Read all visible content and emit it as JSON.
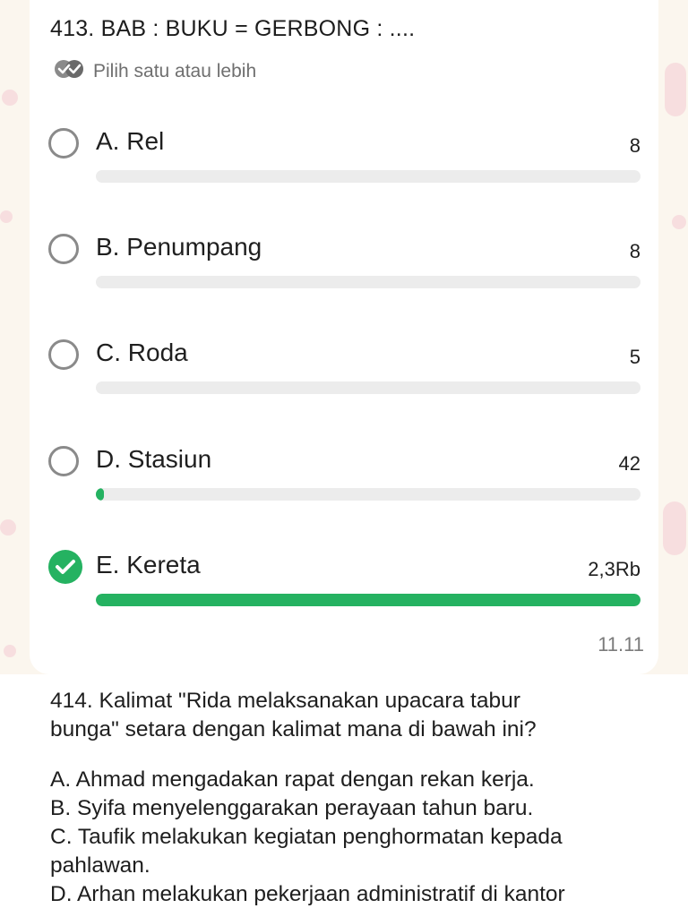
{
  "question": {
    "title": "413. BAB : BUKU = GERBONG : ....",
    "hint": "Pilih satu atau lebih",
    "options": [
      {
        "label": "A. Rel",
        "count": "8",
        "percent": 0,
        "selected": false
      },
      {
        "label": "B. Penumpang",
        "count": "8",
        "percent": 0,
        "selected": false
      },
      {
        "label": "C. Roda",
        "count": "5",
        "percent": 0,
        "selected": false
      },
      {
        "label": "D. Stasiun",
        "count": "42",
        "percent": 1.5,
        "selected": false
      },
      {
        "label": "E. Kereta",
        "count": "2,3Rb",
        "percent": 100,
        "selected": true
      }
    ],
    "time": "11.11",
    "accent_color": "#25b261"
  },
  "next_question": {
    "line1": "414. Kalimat \"Rida melaksanakan upacara tabur",
    "line2": "bunga\" setara dengan kalimat mana di bawah ini?",
    "choice_a": "A. Ahmad mengadakan rapat dengan rekan kerja.",
    "choice_b": "B. Syifa menyelenggarakan perayaan tahun baru.",
    "choice_c1": "C. Taufik melakukan kegiatan penghormatan kepada",
    "choice_c2": "pahlawan.",
    "choice_d": "D. Arhan melakukan pekerjaan administratif di kantor"
  }
}
